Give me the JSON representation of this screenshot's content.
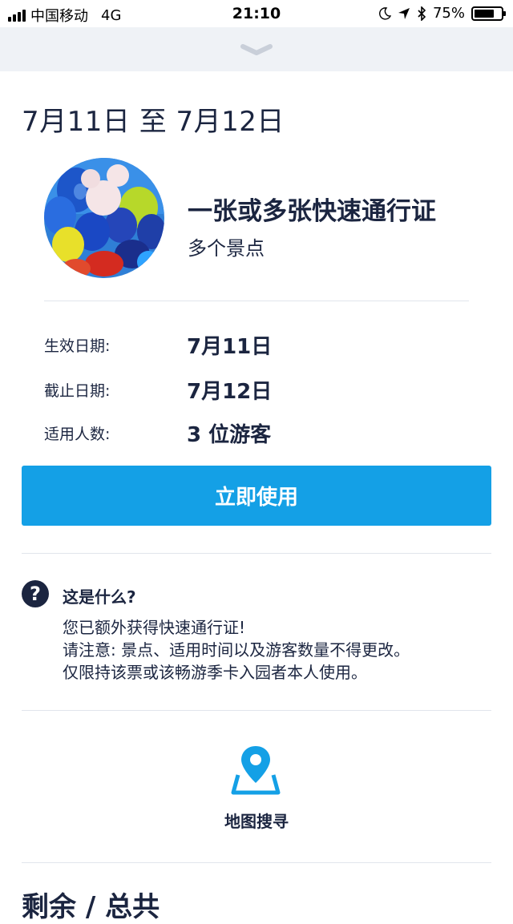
{
  "status_bar": {
    "carrier": "中国移动",
    "network": "4G",
    "time": "21:10",
    "battery_percent_label": "75%",
    "battery_level": 0.75
  },
  "drawer": {
    "handle_icon": "chevron-down-icon"
  },
  "header": {
    "date_range": "7月11日 至 7月12日"
  },
  "pass": {
    "title": "一张或多张快速通行证",
    "subtitle": "多个景点"
  },
  "details": {
    "rows": [
      {
        "label": "生效日期:",
        "value": "7月11日"
      },
      {
        "label": "截止日期:",
        "value": "7月12日"
      },
      {
        "label": "适用人数:",
        "value": "3 位游客"
      }
    ]
  },
  "actions": {
    "use_now_label": "立即使用"
  },
  "faq": {
    "title": "这是什么?",
    "lines": [
      "您已额外获得快速通行证!",
      "请注意: 景点、适用时间以及游客数量不得更改。",
      "仅限持该票或该畅游季卡入园者本人使用。"
    ]
  },
  "map_search": {
    "label": "地图搜寻",
    "icon": "map-pin-icon"
  },
  "remaining": {
    "title": "剩余 / 总共"
  },
  "colors": {
    "primary_button": "#14a0e6",
    "text_dark": "#1b2540",
    "map_icon": "#14a0e6",
    "drawer_bg": "#eff2f6"
  }
}
